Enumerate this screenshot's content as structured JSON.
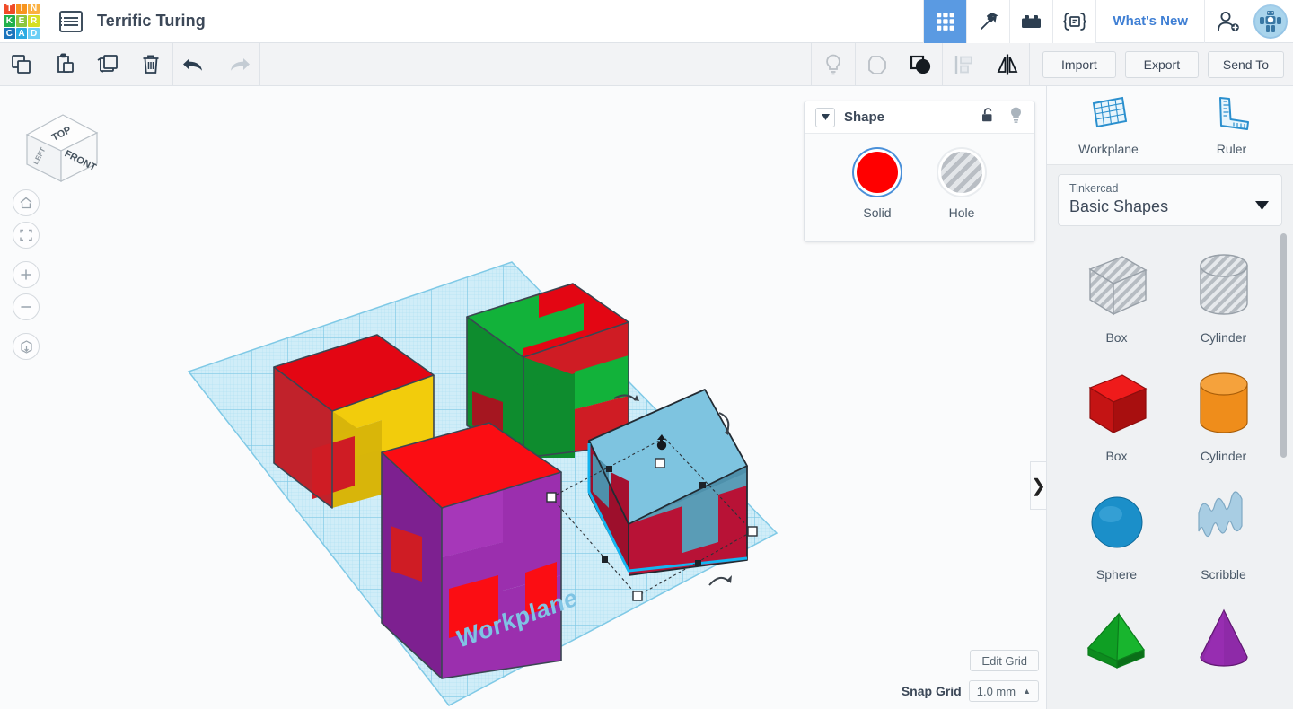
{
  "app": {
    "logo_letters": [
      {
        "ch": "T",
        "color": "#f04b28"
      },
      {
        "ch": "I",
        "color": "#f7941e"
      },
      {
        "ch": "N",
        "color": "#fbb040"
      },
      {
        "ch": "K",
        "color": "#22b14c"
      },
      {
        "ch": "E",
        "color": "#8cc63f"
      },
      {
        "ch": "R",
        "color": "#d7df23"
      },
      {
        "ch": "C",
        "color": "#1c75bc"
      },
      {
        "ch": "A",
        "color": "#29abe2"
      },
      {
        "ch": "D",
        "color": "#6dcff6"
      }
    ],
    "document_title": "Terrific Turing",
    "menu_icon": "list-menu-icon"
  },
  "topbar": {
    "nav_items": [
      {
        "name": "grid-dashboard-icon",
        "active": true
      },
      {
        "name": "pickaxe-icon",
        "active": false
      },
      {
        "name": "lego-brick-icon",
        "active": false
      },
      {
        "name": "codeblocks-icon",
        "active": false
      }
    ],
    "whats_new": "What's New",
    "add_user_icon": "add-person-icon",
    "avatar_icon": "user-avatar-robot"
  },
  "toolbar": {
    "copy_label": "Copy",
    "paste_label": "Paste",
    "duplicate_label": "Duplicate",
    "delete_label": "Delete",
    "undo_label": "Undo",
    "redo_label": "Redo",
    "lightbulb_label": "Light",
    "shape_label": "Shape",
    "group_label": "Group",
    "align_label": "Align",
    "mirror_label": "Mirror",
    "import_label": "Import",
    "export_label": "Export",
    "send_to_label": "Send To"
  },
  "shape_panel": {
    "title": "Shape",
    "lock_icon": "unlocked-padlock-icon",
    "light_icon": "lightbulb-icon",
    "options": [
      {
        "label": "Solid",
        "color": "#ff0000",
        "selected": true
      },
      {
        "label": "Hole",
        "color": "#b9bec4",
        "selected": false
      }
    ]
  },
  "viewport": {
    "viewcube_faces": {
      "top": "TOP",
      "front": "FRONT",
      "left": "LEFT"
    },
    "controls": [
      {
        "name": "home-view-button",
        "icon": "home-icon"
      },
      {
        "name": "fit-to-view-button",
        "icon": "fit-brackets-icon"
      },
      {
        "name": "zoom-in-button",
        "icon": "plus-icon"
      },
      {
        "name": "zoom-out-button",
        "icon": "minus-icon"
      },
      {
        "name": "projection-toggle-button",
        "icon": "cube-projection-icon"
      }
    ],
    "workplane_label": "Workplane",
    "collapse_chevron": "❯",
    "grid_color": "#bfe8f7",
    "objects": [
      {
        "name": "puzzle-cube-yellow",
        "color": "#f2cc0c",
        "accent": "#e01010",
        "selected": false
      },
      {
        "name": "puzzle-cube-green",
        "color": "#12b23a",
        "accent": "#e01010",
        "selected": false
      },
      {
        "name": "puzzle-cube-purple",
        "color": "#9b2fae",
        "accent": "#f01010",
        "selected": false
      },
      {
        "name": "puzzle-cube-blue",
        "color": "#7ec4e0",
        "accent": "#b81236",
        "selected": true
      }
    ]
  },
  "sidebar": {
    "tools": [
      {
        "label": "Workplane",
        "icon": "workplane-grid-icon"
      },
      {
        "label": "Ruler",
        "icon": "ruler-icon"
      }
    ],
    "library": {
      "provider": "Tinkercad",
      "collection": "Basic Shapes",
      "caret_icon": "chevron-down-icon"
    },
    "shapes": [
      {
        "label": "Box",
        "kind": "hole-box"
      },
      {
        "label": "Cylinder",
        "kind": "hole-cylinder"
      },
      {
        "label": "Box",
        "kind": "solid-box",
        "color": "#d11212"
      },
      {
        "label": "Cylinder",
        "kind": "solid-cylinder",
        "color": "#ef8d1b"
      },
      {
        "label": "Sphere",
        "kind": "sphere",
        "color": "#1b8fc9"
      },
      {
        "label": "Scribble",
        "kind": "scribble",
        "color": "#a8cde3"
      },
      {
        "label": "",
        "kind": "roof",
        "color": "#18b52e"
      },
      {
        "label": "",
        "kind": "cone",
        "color": "#8e2aa8"
      }
    ]
  },
  "bottom": {
    "edit_grid_label": "Edit Grid",
    "snap_grid_label": "Snap Grid",
    "snap_grid_value": "1.0 mm",
    "snap_caret": "▲"
  }
}
